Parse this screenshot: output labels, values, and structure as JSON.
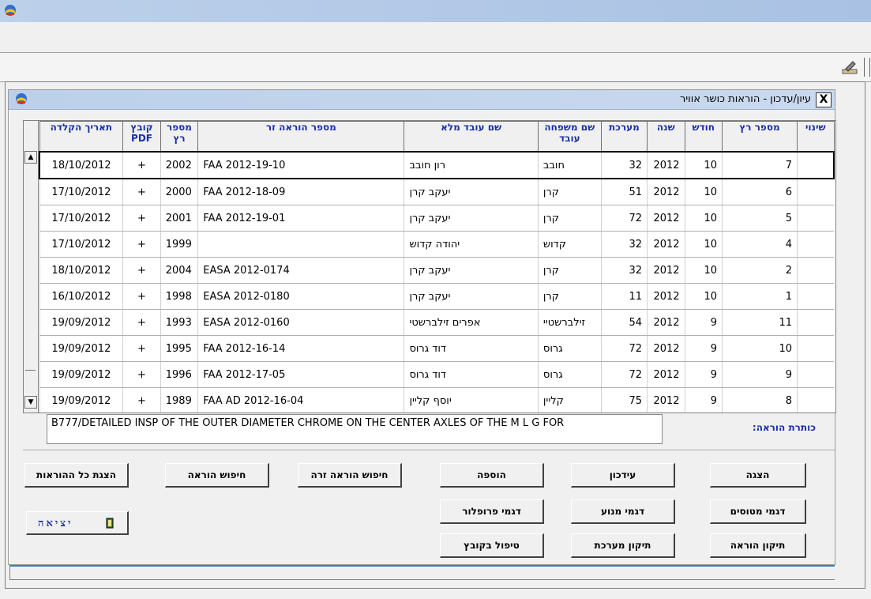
{
  "dialog": {
    "title": "עיון/עדכון - הוראות כושר אוויר",
    "close_glyph": "X"
  },
  "grid": {
    "columns": [
      "שינוי",
      "מספר רץ",
      "חודש",
      "שנה",
      "מערכת",
      "שם משפחה עובד",
      "שם עובד מלא",
      "מספר הוראה זר",
      "מספר רץ",
      "קובץ PDF",
      "תאריך הקלדה"
    ],
    "rows": [
      {
        "run": "7",
        "month": "10",
        "year": "2012",
        "system": "32",
        "last": "חובב",
        "full": "רון חובב",
        "foreign": "FAA 2012-19-10",
        "num": "2002",
        "pdf": "+",
        "date": "18/10/2012"
      },
      {
        "run": "6",
        "month": "10",
        "year": "2012",
        "system": "51",
        "last": "קרן",
        "full": "יעקב קרן",
        "foreign": "FAA 2012-18-09",
        "num": "2000",
        "pdf": "+",
        "date": "17/10/2012"
      },
      {
        "run": "5",
        "month": "10",
        "year": "2012",
        "system": "72",
        "last": "קרן",
        "full": "יעקב קרן",
        "foreign": "FAA 2012-19-01",
        "num": "2001",
        "pdf": "+",
        "date": "17/10/2012"
      },
      {
        "run": "4",
        "month": "10",
        "year": "2012",
        "system": "32",
        "last": "קדוש",
        "full": "יהודה קדוש",
        "foreign": "",
        "num": "1999",
        "pdf": "+",
        "date": "17/10/2012"
      },
      {
        "run": "2",
        "month": "10",
        "year": "2012",
        "system": "32",
        "last": "קרן",
        "full": "יעקב קרן",
        "foreign": "EASA 2012-0174",
        "num": "2004",
        "pdf": "+",
        "date": "18/10/2012"
      },
      {
        "run": "1",
        "month": "10",
        "year": "2012",
        "system": "11",
        "last": "קרן",
        "full": "יעקב קרן",
        "foreign": "EASA 2012-0180",
        "num": "1998",
        "pdf": "+",
        "date": "16/10/2012"
      },
      {
        "run": "11",
        "month": "9",
        "year": "2012",
        "system": "54",
        "last": "זילברשטיי",
        "full": "אפרים זילברשטי",
        "foreign": "EASA 2012-0160",
        "num": "1993",
        "pdf": "+",
        "date": "19/09/2012"
      },
      {
        "run": "10",
        "month": "9",
        "year": "2012",
        "system": "72",
        "last": "גרוס",
        "full": "דוד גרוס",
        "foreign": "FAA 2012-16-14",
        "num": "1995",
        "pdf": "+",
        "date": "19/09/2012"
      },
      {
        "run": "9",
        "month": "9",
        "year": "2012",
        "system": "72",
        "last": "גרוס",
        "full": "דוד גרוס",
        "foreign": "FAA 2012-17-05",
        "num": "1996",
        "pdf": "+",
        "date": "19/09/2012"
      },
      {
        "run": "8",
        "month": "9",
        "year": "2012",
        "system": "75",
        "last": "קליין",
        "full": "יוסף קליין",
        "foreign": "FAA AD 2012-16-04",
        "num": "1989",
        "pdf": "+",
        "date": "19/09/2012"
      }
    ]
  },
  "title_field": {
    "label": "כותרת הוראה:",
    "value": "B777/DETAILED INSP OF THE OUTER DIAMETER CHROME ON THE CENTER AXLES OF THE M L G FOR"
  },
  "buttons": {
    "show": "הצגה",
    "update": "עידכון",
    "add": "הוספה",
    "search_foreign": "חיפוש הוראה זרה",
    "search": "חיפוש הוראה",
    "show_all": "הצגת כל ההוראות",
    "aircraft_models": "דגמי מטוסים",
    "engine_models": "דגמי מנוע",
    "propeller_models": "דגמי פרופלור",
    "fix_instruction": "תיקון הוראה",
    "fix_system": "תיקון מערכת",
    "file_handling": "טיפול בקובץ",
    "exit": "יציאה"
  },
  "colors": {
    "header_text": "#1a2fa8",
    "titlebar": "#bcd0ea"
  },
  "icons": [
    "app-icon",
    "toolbar-edit-icon",
    "dialog-icon",
    "scroll-up-icon",
    "scroll-down-icon",
    "exit-door-icon"
  ]
}
